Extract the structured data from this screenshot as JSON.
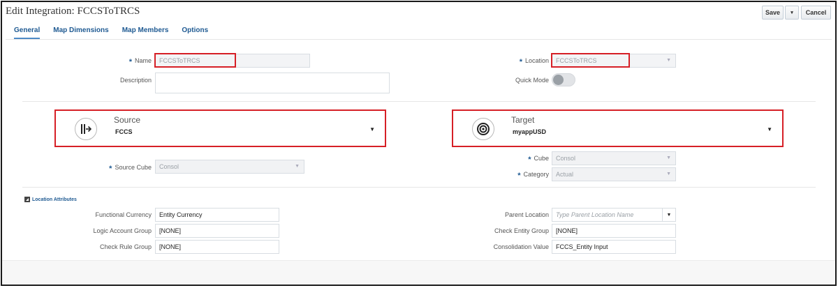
{
  "header": {
    "title": "Edit Integration: FCCSToTRCS",
    "save_label": "Save",
    "dropdown_label": "▾",
    "cancel_label": "Cancel"
  },
  "tabs": [
    {
      "label": "General",
      "active": true
    },
    {
      "label": "Map Dimensions"
    },
    {
      "label": "Map Members"
    },
    {
      "label": "Options"
    }
  ],
  "general": {
    "name_label": "Name",
    "name_value": "FCCSToTRCS",
    "description_label": "Description",
    "description_value": "",
    "location_label": "Location",
    "location_value": "FCCSToTRCS",
    "quick_mode_label": "Quick Mode",
    "quick_mode_on": false
  },
  "source": {
    "title": "Source",
    "value": "FCCS",
    "icon": "source-import-icon",
    "cube_label": "Source Cube",
    "cube_value": "Consol"
  },
  "target": {
    "title": "Target",
    "value": "myappUSD",
    "icon": "target-icon",
    "cube_label": "Cube",
    "cube_value": "Consol",
    "category_label": "Category",
    "category_value": "Actual"
  },
  "location_attributes": {
    "section_label": "Location Attributes",
    "functional_currency_label": "Functional Currency",
    "functional_currency_value": "Entity Currency",
    "logic_account_group_label": "Logic Account Group",
    "logic_account_group_value": "[NONE]",
    "check_rule_group_label": "Check Rule Group",
    "check_rule_group_value": "[NONE]",
    "parent_location_label": "Parent Location",
    "parent_location_placeholder": "Type Parent Location Name",
    "check_entity_group_label": "Check Entity Group",
    "check_entity_group_value": "[NONE]",
    "consolidation_value_label": "Consolidation Value",
    "consolidation_value_value": "FCCS_Entity Input"
  },
  "colors": {
    "accent": "#1f5a92",
    "highlight_border": "#d61f26"
  }
}
